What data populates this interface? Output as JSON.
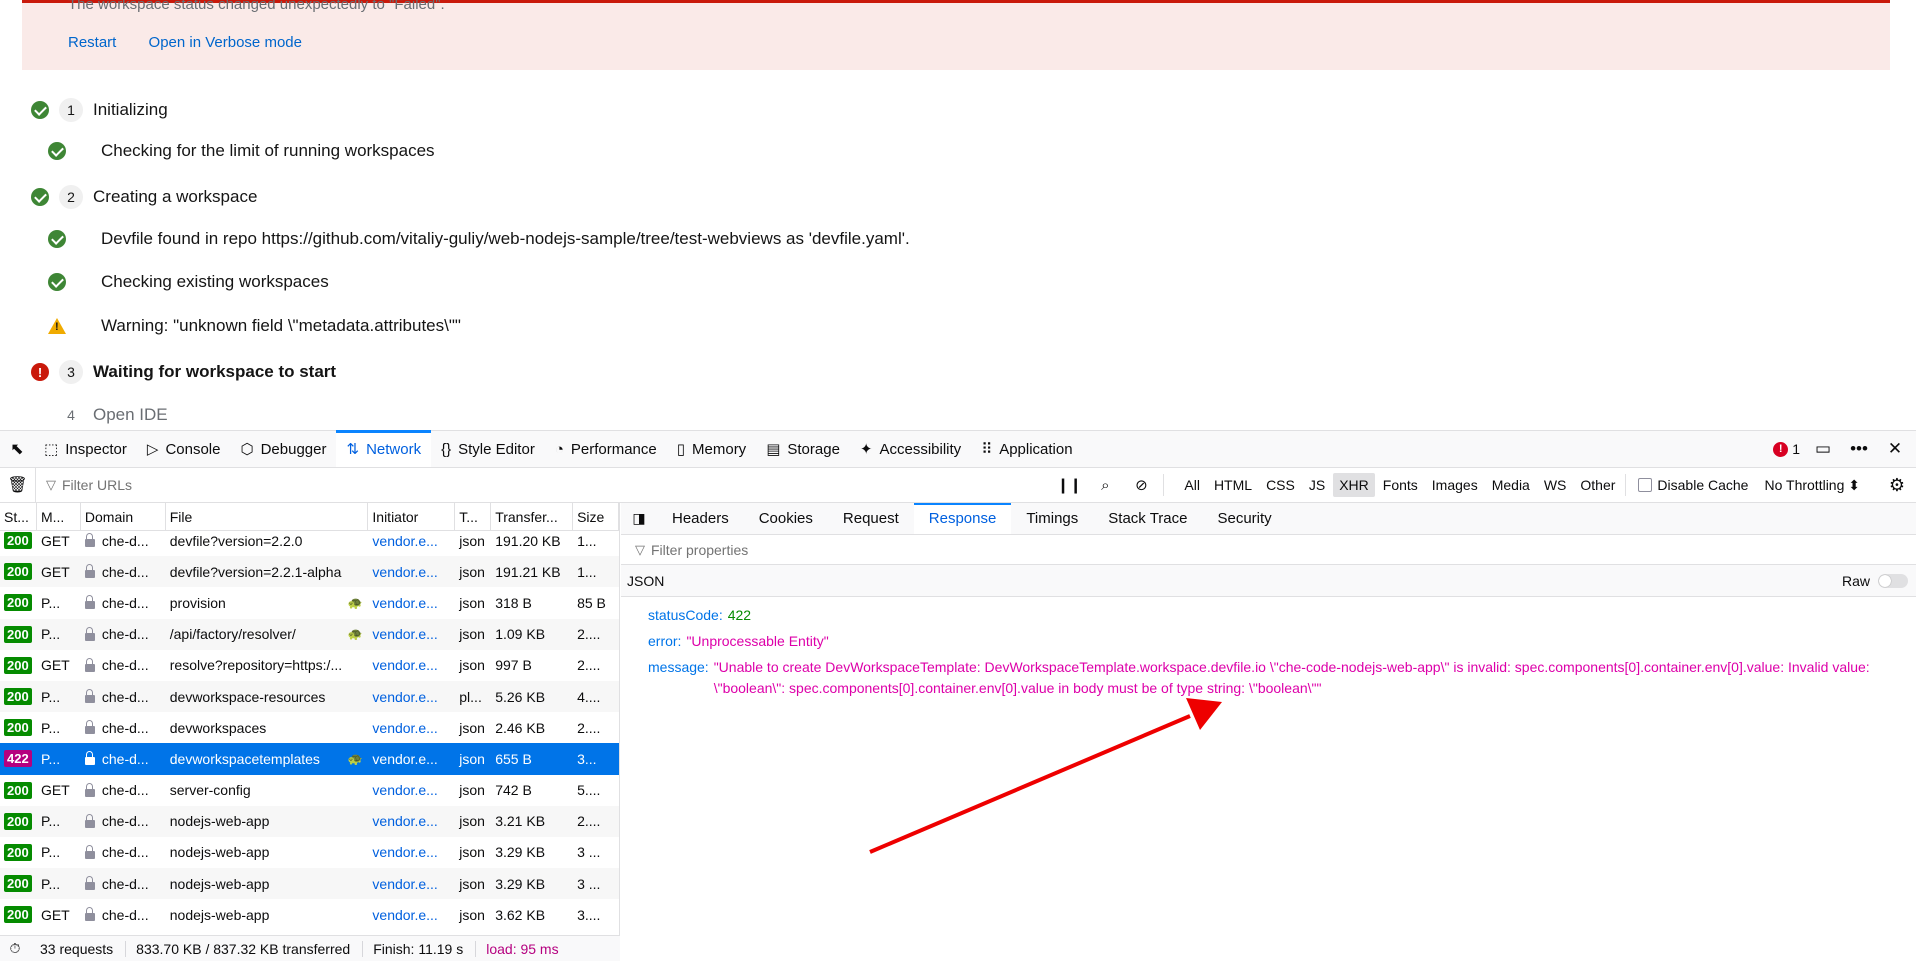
{
  "alert": {
    "message": "The workspace status changed unexpectedly to \"Failed\".",
    "actions": [
      "Restart",
      "Open in Verbose mode"
    ]
  },
  "steps": [
    {
      "kind": "major",
      "status": "ok",
      "number": "1",
      "label": "Initializing"
    },
    {
      "kind": "sub",
      "status": "ok",
      "label": "Checking for the limit of running workspaces"
    },
    {
      "kind": "major",
      "status": "ok",
      "number": "2",
      "label": "Creating a workspace"
    },
    {
      "kind": "sub",
      "status": "ok",
      "label": "Devfile found in repo https://github.com/vitaliy-guliy/web-nodejs-sample/tree/test-webviews as 'devfile.yaml'."
    },
    {
      "kind": "sub",
      "status": "ok",
      "label": "Checking existing workspaces"
    },
    {
      "kind": "sub",
      "status": "warn",
      "label": "Warning: \"unknown field \\\"metadata.attributes\\\"\""
    },
    {
      "kind": "major",
      "status": "err",
      "number": "3",
      "label": "Waiting for workspace to start"
    },
    {
      "kind": "major",
      "status": "none",
      "number": "4",
      "label": "Open IDE"
    }
  ],
  "devtools": {
    "tabs": [
      {
        "id": "inspector",
        "icon": "inspector-icon",
        "glyph": "⬚",
        "label": "Inspector"
      },
      {
        "id": "console",
        "icon": "console-icon",
        "glyph": "▷",
        "label": "Console"
      },
      {
        "id": "debugger",
        "icon": "debugger-icon",
        "glyph": "⬡",
        "label": "Debugger"
      },
      {
        "id": "network",
        "icon": "network-icon",
        "glyph": "⇅",
        "label": "Network"
      },
      {
        "id": "style-editor",
        "icon": "style-editor-icon",
        "glyph": "{}",
        "label": "Style Editor"
      },
      {
        "id": "performance",
        "icon": "performance-icon",
        "glyph": "◔",
        "label": "Performance"
      },
      {
        "id": "memory",
        "icon": "memory-icon",
        "glyph": "▯",
        "label": "Memory"
      },
      {
        "id": "storage",
        "icon": "storage-icon",
        "glyph": "▤",
        "label": "Storage"
      },
      {
        "id": "accessibility",
        "icon": "accessibility-icon",
        "glyph": "✦",
        "label": "Accessibility"
      },
      {
        "id": "application",
        "icon": "application-icon",
        "glyph": "⠿",
        "label": "Application"
      }
    ],
    "active_tab": "network",
    "error_count": "1",
    "toolbar": {
      "filter_placeholder": "Filter URLs",
      "types": [
        "All",
        "HTML",
        "CSS",
        "JS",
        "XHR",
        "Fonts",
        "Images",
        "Media",
        "WS",
        "Other"
      ],
      "active_type": "XHR",
      "disable_cache_label": "Disable Cache",
      "throttling": "No Throttling ⬍"
    },
    "columns": [
      "St...",
      "M...",
      "Domain",
      "File",
      "Initiator",
      "T...",
      "Transfer...",
      "Size"
    ],
    "requests": [
      {
        "status": "200",
        "method": "GET",
        "domain": "che-d...",
        "file": "devfile?version=2.2.0",
        "tracker": false,
        "initiator": "vendor.e...",
        "type": "json",
        "transferred": "191.20 KB",
        "size": "1..."
      },
      {
        "status": "200",
        "method": "GET",
        "domain": "che-d...",
        "file": "devfile?version=2.2.1-alpha",
        "tracker": false,
        "initiator": "vendor.e...",
        "type": "json",
        "transferred": "191.21 KB",
        "size": "1..."
      },
      {
        "status": "200",
        "method": "P...",
        "domain": "che-d...",
        "file": "provision",
        "tracker": true,
        "initiator": "vendor.e...",
        "type": "json",
        "transferred": "318 B",
        "size": "85 B"
      },
      {
        "status": "200",
        "method": "P...",
        "domain": "che-d...",
        "file": "/api/factory/resolver/",
        "tracker": true,
        "initiator": "vendor.e...",
        "type": "json",
        "transferred": "1.09 KB",
        "size": "2...."
      },
      {
        "status": "200",
        "method": "GET",
        "domain": "che-d...",
        "file": "resolve?repository=https:/...",
        "tracker": false,
        "initiator": "vendor.e...",
        "type": "json",
        "transferred": "997 B",
        "size": "2...."
      },
      {
        "status": "200",
        "method": "P...",
        "domain": "che-d...",
        "file": "devworkspace-resources",
        "tracker": false,
        "initiator": "vendor.e...",
        "type": "pl...",
        "transferred": "5.26 KB",
        "size": "4...."
      },
      {
        "status": "200",
        "method": "P...",
        "domain": "che-d...",
        "file": "devworkspaces",
        "tracker": false,
        "initiator": "vendor.e...",
        "type": "json",
        "transferred": "2.46 KB",
        "size": "2...."
      },
      {
        "status": "422",
        "method": "P...",
        "domain": "che-d...",
        "file": "devworkspacetemplates",
        "tracker": true,
        "initiator": "vendor.e...",
        "type": "json",
        "transferred": "655 B",
        "size": "3...",
        "selected": true
      },
      {
        "status": "200",
        "method": "GET",
        "domain": "che-d...",
        "file": "server-config",
        "tracker": false,
        "initiator": "vendor.e...",
        "type": "json",
        "transferred": "742 B",
        "size": "5...."
      },
      {
        "status": "200",
        "method": "P...",
        "domain": "che-d...",
        "file": "nodejs-web-app",
        "tracker": false,
        "initiator": "vendor.e...",
        "type": "json",
        "transferred": "3.21 KB",
        "size": "2...."
      },
      {
        "status": "200",
        "method": "P...",
        "domain": "che-d...",
        "file": "nodejs-web-app",
        "tracker": false,
        "initiator": "vendor.e...",
        "type": "json",
        "transferred": "3.29 KB",
        "size": "3 ..."
      },
      {
        "status": "200",
        "method": "P...",
        "domain": "che-d...",
        "file": "nodejs-web-app",
        "tracker": false,
        "initiator": "vendor.e...",
        "type": "json",
        "transferred": "3.29 KB",
        "size": "3 ..."
      },
      {
        "status": "200",
        "method": "GET",
        "domain": "che-d...",
        "file": "nodejs-web-app",
        "tracker": false,
        "initiator": "vendor.e...",
        "type": "json",
        "transferred": "3.62 KB",
        "size": "3...."
      }
    ],
    "summary": {
      "requests": "33 requests",
      "size": "833.70 KB / 837.32 KB transferred",
      "finish": "Finish: 11.19 s",
      "load": "load: 95 ms"
    },
    "detail_tabs": [
      "Headers",
      "Cookies",
      "Request",
      "Response",
      "Timings",
      "Stack Trace",
      "Security"
    ],
    "active_detail_tab": "Response",
    "property_filter_placeholder": "Filter properties",
    "json_label": "JSON",
    "raw_label": "Raw",
    "response": {
      "statusCode_key": "statusCode:",
      "statusCode_value": "422",
      "error_key": "error:",
      "error_value": "\"Unprocessable Entity\"",
      "message_key": "message:",
      "message_value": "\"Unable to create DevWorkspaceTemplate: DevWorkspaceTemplate.workspace.devfile.io \\\"che-code-nodejs-web-app\\\" is invalid: spec.components[0].container.env[0].value: Invalid value: \\\"boolean\\\": spec.components[0].container.env[0].value in body must be of type string: \\\"boolean\\\"\""
    }
  },
  "annotation": {
    "color": "#ee0000"
  }
}
